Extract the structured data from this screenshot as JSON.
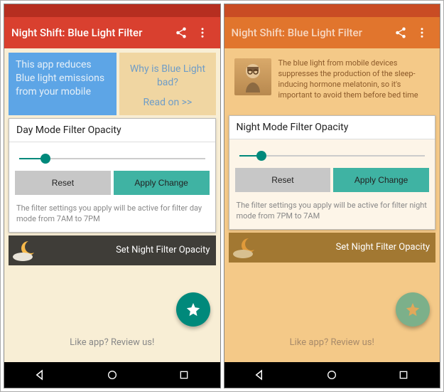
{
  "left": {
    "app_title": "Night Shift: Blue Light Filter",
    "intro_left": "This app reduces Blue light emissions from your mobile",
    "intro_right_title": "Why is Blue Light bad?",
    "intro_right_link": "Read on >>",
    "opacity_title": "Day Mode Filter Opacity",
    "reset_label": "Reset",
    "apply_label": "Apply Change",
    "hint": "The filter settings you apply will be active for filter day mode from 7AM to 7PM",
    "night_strip": "Set Night Filter Opacity",
    "review": "Like app? Review us!",
    "slider_value_pct": 14
  },
  "right": {
    "app_title": "Night Shift: Blue Light Filter",
    "intro_paragraph": "The blue light from mobile devices suppresses the production of the sleep-inducing hormone melatonin, so it's important to avoid them before bed time",
    "opacity_title": "Night Mode Filter Opacity",
    "reset_label": "Reset",
    "apply_label": "Apply Change",
    "hint": "The filter settings you apply will be active for filter night mode from 7PM to 7AM",
    "night_strip": "Set Night Filter Opacity",
    "review": "Like app? Review us!",
    "slider_value_pct": 12
  },
  "icons": {
    "share": "share-icon",
    "overflow": "overflow-icon",
    "star": "star-icon",
    "back": "back-icon",
    "home": "home-icon",
    "recent": "recent-icon",
    "moon": "moon-icon",
    "avatar": "person-avatar"
  },
  "colors": {
    "day_primary": "#d9402f",
    "night_primary": "#e1752d",
    "accent_teal": "#00897b"
  }
}
